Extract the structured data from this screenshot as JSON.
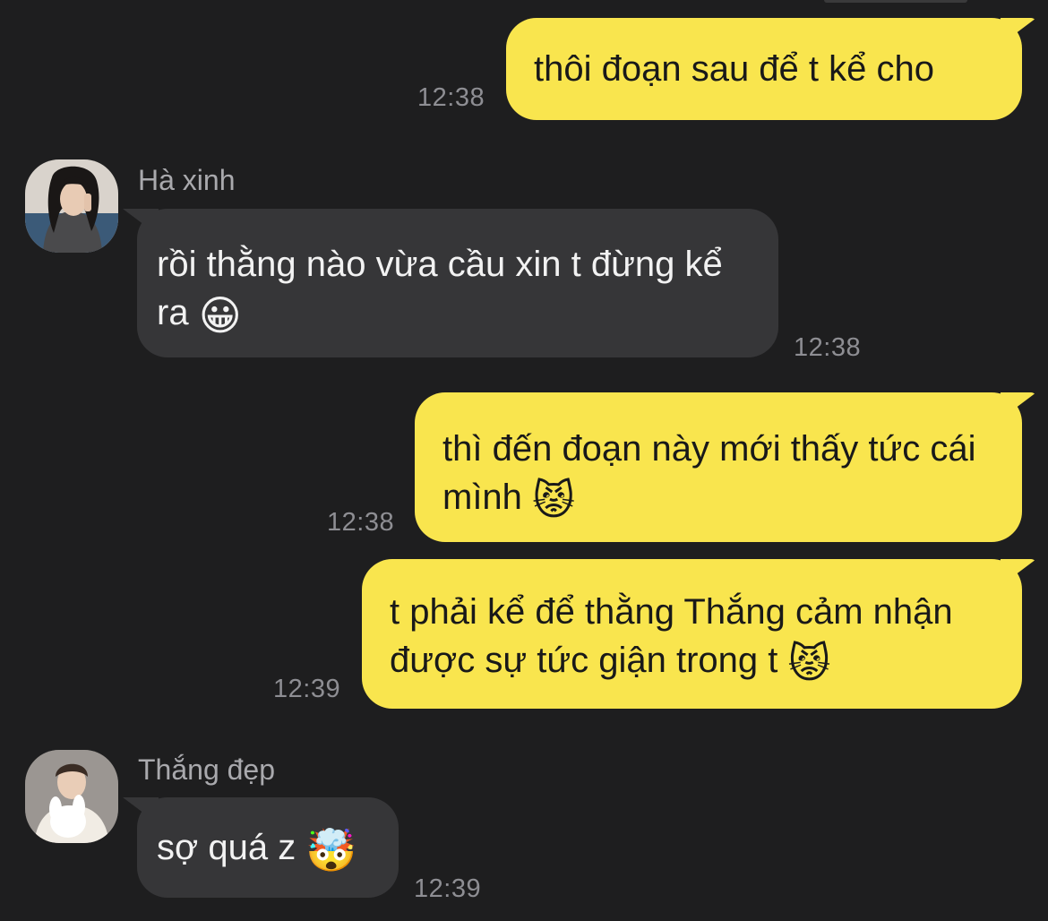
{
  "messages": [
    {
      "direction": "outgoing",
      "text": "thôi đoạn sau để t kể cho",
      "time": "12:38"
    },
    {
      "direction": "incoming",
      "sender": "Hà xinh",
      "text": "rồi thằng nào vừa cầu xin t đừng kể ra",
      "emoji": "😀",
      "time": "12:38"
    },
    {
      "direction": "outgoing",
      "text": "thì đến đoạn này mới thấy tức cái mình",
      "emoji": "😾",
      "time": "12:38"
    },
    {
      "direction": "outgoing",
      "text": "t phải kể để thằng Thắng cảm nhận được sự tức giận trong t",
      "emoji": "😾",
      "time": "12:39"
    },
    {
      "direction": "incoming",
      "sender": "Thắng đẹp",
      "text": "sợ quá z",
      "emoji": "🤯",
      "time": "12:39"
    }
  ],
  "colors": {
    "background": "#1e1e1f",
    "outgoing_bubble": "#f9e54e",
    "incoming_bubble": "#363638",
    "timestamp": "#8e8e93",
    "sender_name": "#a9a9ad"
  }
}
